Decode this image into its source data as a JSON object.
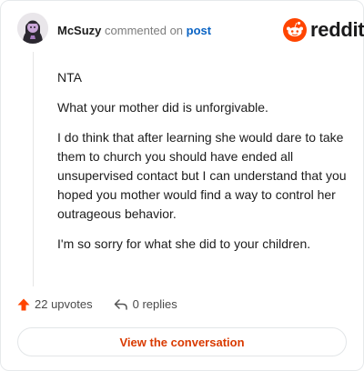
{
  "header": {
    "username": "McSuzy",
    "action": "commented on",
    "target": "post"
  },
  "brand": {
    "name": "reddit"
  },
  "comment": {
    "paragraphs": [
      "NTA",
      "What your mother did is unforgivable.",
      "I do think that after learning she would dare to take them to church you should have ended all unsupervised contact but I can understand that you hoped you mother would find a way to control her outrageous behavior.",
      "I'm so sorry for what she did to your children."
    ]
  },
  "stats": {
    "upvotes": "22 upvotes",
    "replies": "0 replies"
  },
  "cta": {
    "label": "View the conversation"
  },
  "colors": {
    "accent": "#d93a00",
    "upvote": "#ff4500",
    "link": "#0a63c4"
  },
  "icons": [
    "avatar",
    "reddit-logo-icon",
    "upvote-arrow-icon",
    "reply-icon"
  ]
}
